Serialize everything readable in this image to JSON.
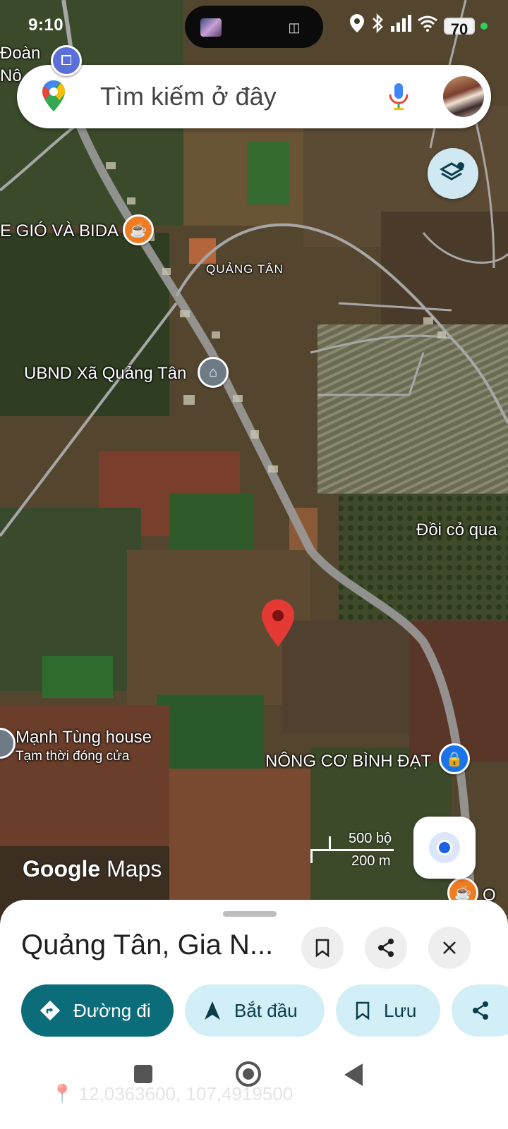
{
  "status_bar": {
    "time": "9:10",
    "battery": "70",
    "icons": [
      "location-icon",
      "bluetooth-icon",
      "signal-icon",
      "wifi-icon"
    ]
  },
  "search": {
    "placeholder": "Tìm kiếm ở đây"
  },
  "map": {
    "labels": {
      "doan": "Đoàn",
      "no": "Nô",
      "cafe": "E GIÓ VÀ BIDA",
      "quang_tan": "QUẢNG TÂN",
      "ubnd": "UBND Xã Quảng Tân",
      "doi_co": "Đồi cỏ qua",
      "manh_tung": "Mạnh Tùng house",
      "manh_tung_status": "Tạm thời đóng cửa",
      "nong_co": "NÔNG CƠ BÌNH ĐẠT",
      "o": "O"
    },
    "scale": {
      "feet": "500 bộ",
      "meters": "200 m"
    },
    "attribution": {
      "google": "Google",
      "maps": "Maps"
    }
  },
  "place_sheet": {
    "title": "Quảng Tân, Gia N...",
    "actions": {
      "directions": "Đường đi",
      "start": "Bắt đầu",
      "save": "Lưu"
    },
    "coordinates": "12,0363600, 107,4919500"
  },
  "colors": {
    "accent": "#0b6c7a",
    "tonal": "#d2eef6",
    "pin": "#e53935",
    "poi_orange": "#f07c22",
    "poi_blue": "#1a73e8",
    "poi_gray": "#6e7a86"
  }
}
